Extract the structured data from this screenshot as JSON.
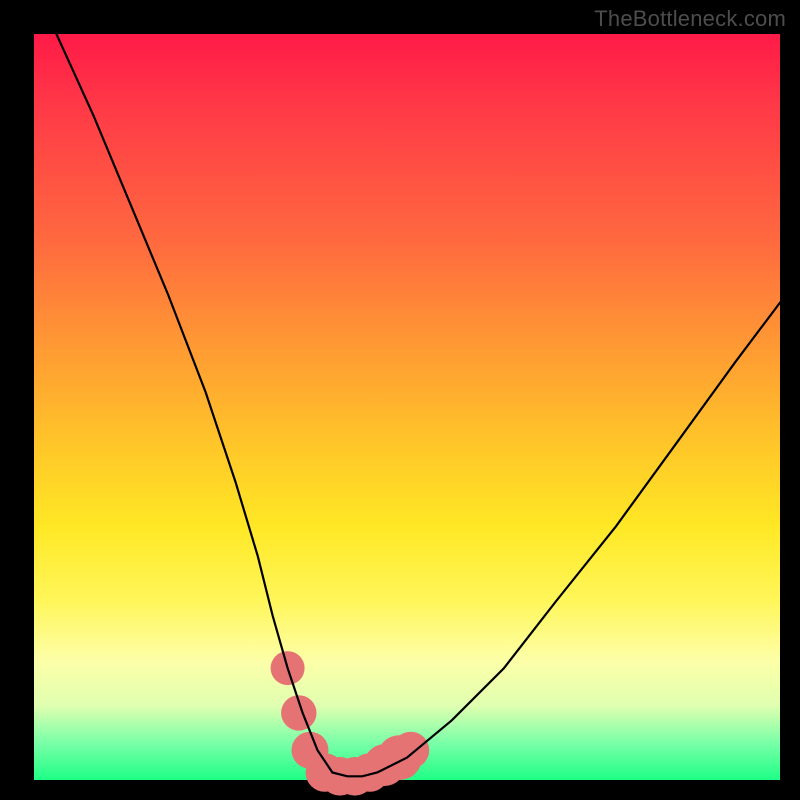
{
  "watermark": {
    "text": "TheBottleneck.com"
  },
  "colors": {
    "page_bg": "#000000",
    "curve_stroke": "#000000",
    "marker_fill": "#e57373",
    "gradient_top": "#ff1a47",
    "gradient_bottom": "#1eff86"
  },
  "chart_data": {
    "type": "line",
    "title": "",
    "xlabel": "",
    "ylabel": "",
    "xlim": [
      0,
      100
    ],
    "ylim": [
      0,
      100
    ],
    "grid": false,
    "legend": null,
    "note": "Values estimated from pixel positions; y=0 at bottom (green), y=100 at top (red). Single V-shaped curve with flat trough.",
    "series": [
      {
        "name": "bottleneck-curve",
        "x": [
          3,
          8,
          13,
          18,
          23,
          27,
          30,
          32,
          34,
          36,
          38,
          40,
          42,
          44,
          46,
          50,
          56,
          63,
          70,
          78,
          86,
          94,
          100
        ],
        "y": [
          100,
          89,
          77,
          65,
          52,
          40,
          30,
          22,
          15,
          9,
          4,
          1,
          0.5,
          0.5,
          1,
          3,
          8,
          15,
          24,
          34,
          45,
          56,
          64
        ]
      }
    ],
    "markers": {
      "name": "trough-markers",
      "note": "Pink circular markers around the minimum of the curve",
      "points": [
        {
          "x": 34,
          "y": 15,
          "r": 1.4
        },
        {
          "x": 35.5,
          "y": 9,
          "r": 1.5
        },
        {
          "x": 37,
          "y": 4,
          "r": 1.6
        },
        {
          "x": 39,
          "y": 1,
          "r": 1.7
        },
        {
          "x": 41,
          "y": 0.5,
          "r": 1.7
        },
        {
          "x": 43,
          "y": 0.5,
          "r": 1.7
        },
        {
          "x": 45,
          "y": 1,
          "r": 1.7
        },
        {
          "x": 47,
          "y": 2,
          "r": 1.9
        },
        {
          "x": 49,
          "y": 3,
          "r": 2.1
        },
        {
          "x": 50.5,
          "y": 4,
          "r": 1.6
        }
      ]
    }
  }
}
